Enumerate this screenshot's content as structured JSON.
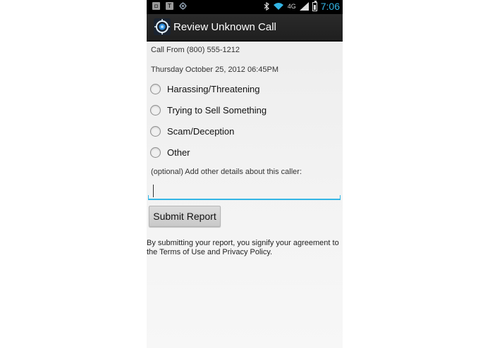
{
  "status_bar": {
    "left_icons": [
      "screenshot-icon",
      "notification-icon",
      "gps-icon"
    ],
    "right_icons": [
      "bluetooth-icon",
      "wifi-icon",
      "signal-icon",
      "battery-icon"
    ],
    "network": "4G",
    "time": "7:06"
  },
  "action_bar": {
    "title": "Review Unknown Call",
    "icon": "app-target-icon"
  },
  "call_info": {
    "from": "Call From (800) 555-1212",
    "datetime": "Thursday October 25, 2012 06:45PM"
  },
  "options": [
    {
      "label": "Harassing/Threatening",
      "selected": false
    },
    {
      "label": "Trying to Sell Something",
      "selected": false
    },
    {
      "label": "Scam/Deception",
      "selected": false
    },
    {
      "label": "Other",
      "selected": false
    }
  ],
  "details": {
    "label": "(optional) Add other details about this caller:",
    "value": "",
    "placeholder": ""
  },
  "submit_label": "Submit Report",
  "footer": "By submitting your report, you signify your agreement to the Terms of Use and Privacy Policy.",
  "colors": {
    "accent": "#33b5e5",
    "actionbar": "#252525",
    "statusbar": "#000000"
  }
}
